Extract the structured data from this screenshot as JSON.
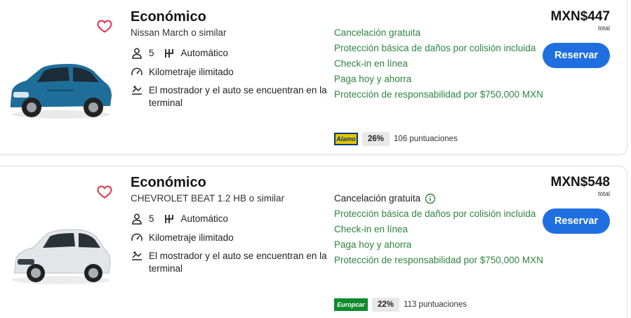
{
  "results": [
    {
      "category": "Económico",
      "model": "Nissan March o similar",
      "passengers": "5",
      "transmission": "Automático",
      "mileage": "Kilometraje ilimitado",
      "pickup": "El mostrador y el auto se encuentran en la terminal",
      "benefits": [
        "Cancelación gratuita",
        "Protección básica de daños por colisión incluida",
        "Check-in en línea",
        "Paga hoy y ahorra",
        "Protección de responsabilidad por $750,000 MXN"
      ],
      "vendor_logo": "Alamo",
      "rating_pct": "26%",
      "rating_count": "106 puntuaciones",
      "price": "MXN$447",
      "price_note": "total",
      "cta": "Reservar",
      "car_color": "#1f6e9a"
    },
    {
      "category": "Económico",
      "model": "CHEVROLET BEAT 1.2 HB o similar",
      "passengers": "5",
      "transmission": "Automático",
      "mileage": "Kilometraje ilimitado",
      "pickup": "El mostrador y el auto se encuentran en la terminal",
      "cancellation": "Cancelación gratuita",
      "benefits": [
        "Protección básica de daños por colisión incluida",
        "Check-in en línea",
        "Paga hoy y ahorra",
        "Protección de responsabilidad por $750,000 MXN"
      ],
      "vendor_logo": "Europcar",
      "rating_pct": "22%",
      "rating_count": "113 puntuaciones",
      "price": "MXN$548",
      "price_note": "total",
      "cta": "Reservar",
      "car_color": "#e6e8ea"
    }
  ],
  "colors": {
    "accent": "#1f6fe0",
    "benefit_green": "#2e8540",
    "heart": "#e0314b"
  },
  "icons": [
    "heart-icon",
    "person-icon",
    "transmission-icon",
    "speedometer-icon",
    "counter-icon",
    "info-icon"
  ]
}
